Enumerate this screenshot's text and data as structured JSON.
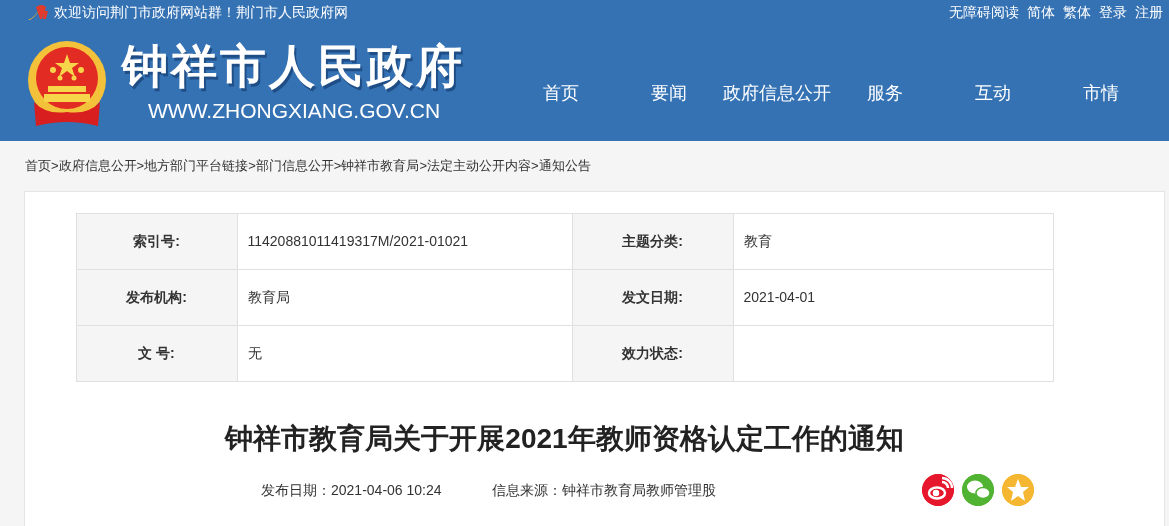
{
  "top_bar": {
    "welcome": "欢迎访问荆门市政府网站群！荆门市人民政府网",
    "links": [
      "无障碍阅读",
      "简体",
      "繁体",
      "登录",
      "注册"
    ]
  },
  "header": {
    "site_name": "钟祥市人民政府",
    "site_url": "WWW.ZHONGXIANG.GOV.CN"
  },
  "nav": [
    {
      "label": "首页"
    },
    {
      "label": "要闻"
    },
    {
      "label": "政府信息公开"
    },
    {
      "label": "服务"
    },
    {
      "label": "互动"
    },
    {
      "label": "市情"
    }
  ],
  "breadcrumb": {
    "separator": ">",
    "items": [
      "首页",
      "政府信息公开",
      "地方部门平台链接",
      "部门信息公开",
      "钟祥市教育局",
      "法定主动公开内容",
      "通知公告"
    ]
  },
  "info_table": [
    [
      {
        "label": "索引号:",
        "value": "11420881011419317M/2021-01021"
      },
      {
        "label": "主题分类:",
        "value": "教育"
      }
    ],
    [
      {
        "label": "发布机构:",
        "value": "教育局"
      },
      {
        "label": "发文日期:",
        "value": "2021-04-01"
      }
    ],
    [
      {
        "label": "文 号:",
        "value": "无"
      },
      {
        "label": "效力状态:"
      }
    ]
  ],
  "article": {
    "title": "钟祥市教育局关于开展2021年教师资格认定工作的通知",
    "publish_date": "发布日期：2021-04-06 10:24",
    "source": "信息来源：钟祥市教育局教师管理股"
  },
  "share": [
    {
      "kind": "weibo",
      "color": "#e6162d"
    },
    {
      "kind": "wechat",
      "color": "#51b332"
    },
    {
      "kind": "qzone",
      "color": "#f5b731"
    }
  ]
}
